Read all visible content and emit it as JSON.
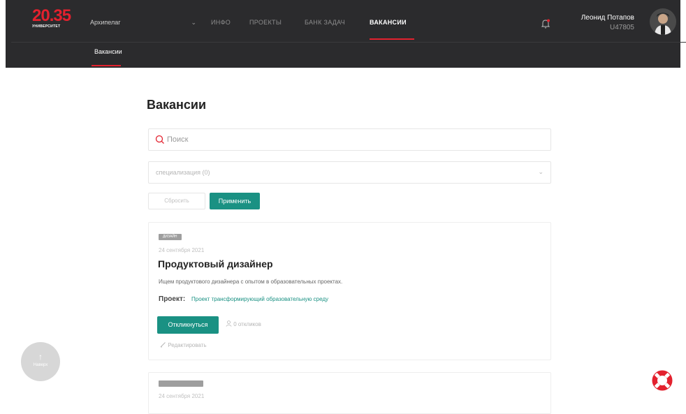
{
  "logo": {
    "number": "20.35",
    "subtitle": "УНИВЕРСИТЕТ"
  },
  "header": {
    "workspace_select": "Архипелаг",
    "nav": [
      {
        "label": "ИНФО"
      },
      {
        "label": "ПРОЕКТЫ"
      },
      {
        "label": "БАНК ЗАДАЧ"
      },
      {
        "label": "ВАКАНСИИ"
      }
    ],
    "user_name": "Леонид Потапов",
    "user_id": "U47805",
    "subnav_tab": "Вакансии"
  },
  "page": {
    "title": "Вакансии",
    "search_placeholder": "Поиск",
    "specialization_placeholder": "специализация (0)",
    "reset_label": "Сбросить",
    "apply_label": "Применить"
  },
  "vacancies": [
    {
      "tag": "ДИЗАЙН",
      "date": "24 сентября 2021",
      "title": "Продуктовый дизайнер",
      "description": "Ищем продуктового дизайнера с опытом в образовательных проектах.",
      "project_label": "Проект:",
      "project_link": "Проект трансформирующий образовательную среду",
      "respond_label": "Откликнуться",
      "responses_label": "0 откликов",
      "edit_label": "Редактировать"
    },
    {
      "date": "24 сентября 2021"
    }
  ],
  "floating": {
    "scroll_up_label": "Наверх"
  },
  "colors": {
    "accent_red": "#e3212e",
    "accent_teal": "#1a9183",
    "header_bg": "#2b2b2d"
  }
}
